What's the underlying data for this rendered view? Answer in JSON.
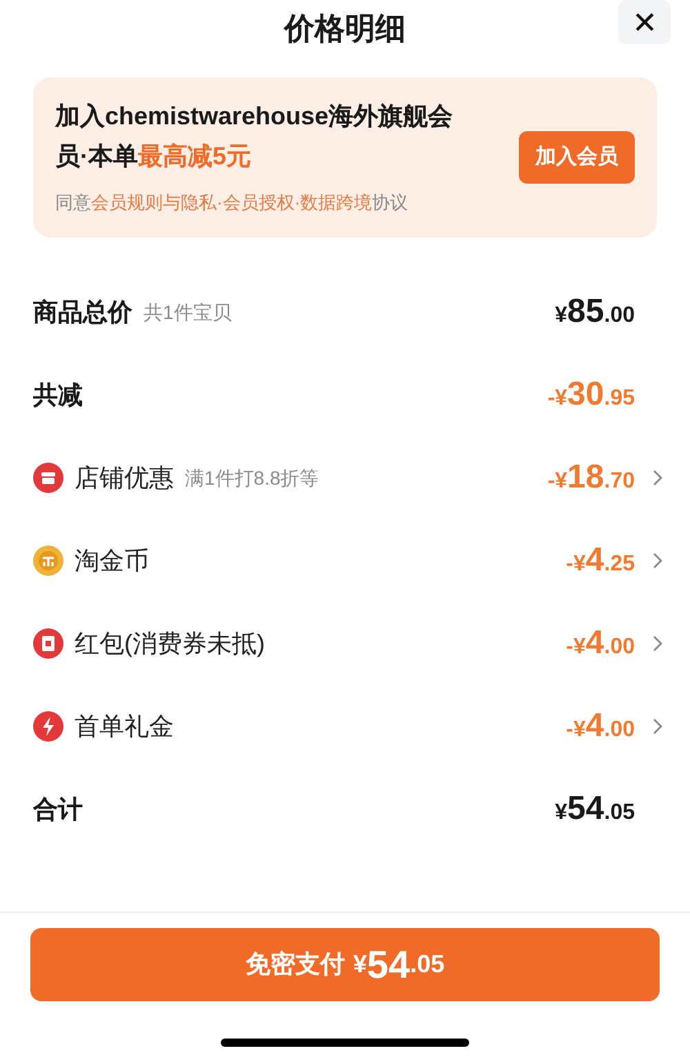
{
  "header": {
    "title": "价格明细",
    "close": "✕"
  },
  "promo": {
    "title": [
      {
        "text": "加入chemistwarehouse海外旗舰会员·本单",
        "highlight": false
      },
      {
        "text": "最高减5元",
        "highlight": true
      }
    ],
    "agreement": [
      {
        "text": "同意",
        "link": false
      },
      {
        "text": "会员规则与隐私·会员授权·数据跨境",
        "link": true
      },
      {
        "text": "协议",
        "link": false
      }
    ],
    "button": "加入会员"
  },
  "rows": [
    {
      "label": "商品总价",
      "note": "共1件宝贝",
      "prefix": "¥",
      "main": "85",
      "fraction": ".00",
      "discount": false,
      "arrow": false
    },
    {
      "label": "共减",
      "prefix": "-¥",
      "main": "30",
      "fraction": ".95",
      "discount": true,
      "arrow": false
    },
    {
      "kind": "store",
      "label": "店铺优惠",
      "note": "满1件打8.8折等",
      "prefix": "-¥",
      "main": "18",
      "fraction": ".70",
      "discount": true,
      "arrow": true
    },
    {
      "kind": "coin",
      "label": "淘金币",
      "prefix": "-¥",
      "main": "4",
      "fraction": ".25",
      "discount": true,
      "arrow": true
    },
    {
      "kind": "envelope",
      "label": "红包(消费券未抵)",
      "prefix": "-¥",
      "main": "4",
      "fraction": ".00",
      "discount": true,
      "arrow": true
    },
    {
      "kind": "bolt",
      "label": "首单礼金",
      "prefix": "-¥",
      "main": "4",
      "fraction": ".00",
      "discount": true,
      "arrow": true
    },
    {
      "label": "合计",
      "prefix": "¥",
      "main": "54",
      "fraction": ".05",
      "discount": false,
      "arrow": false
    }
  ],
  "pay_button": {
    "label": "免密支付",
    "prefix": "¥",
    "main": "54",
    "fraction": ".05"
  }
}
